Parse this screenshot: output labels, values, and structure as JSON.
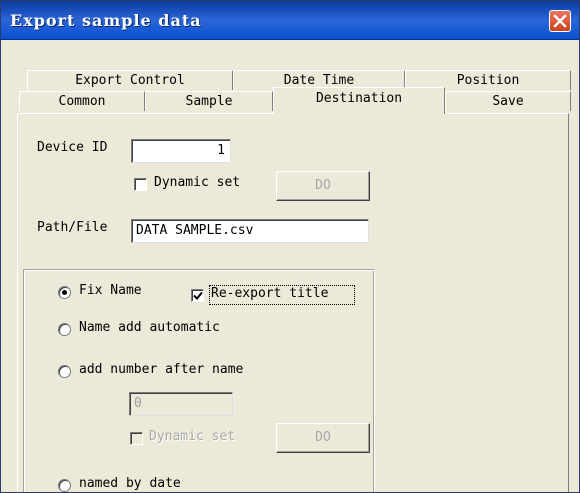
{
  "window": {
    "title": "Export sample data",
    "close_icon": "close-icon"
  },
  "tabs": {
    "back_row": [
      "Export Control",
      "Date Time",
      "Position"
    ],
    "front_row": [
      "Common",
      "Sample",
      "Destination",
      "Save"
    ],
    "active": "Destination"
  },
  "destination": {
    "device_id_label": "Device ID",
    "device_id_value": "1",
    "dynamic_set_label": "Dynamic set",
    "dynamic_set_checked": false,
    "do_button": "DO",
    "path_label": "Path/File",
    "path_value": "DATA SAMPLE.csv",
    "naming": {
      "fix_name": "Fix Name",
      "re_export_title": "Re-export title",
      "re_export_checked": true,
      "name_add_automatic": "Name add automatic",
      "add_number_after_name": "add number after name",
      "number_value": "0",
      "dynamic_set_label": "Dynamic set",
      "do_button": "DO",
      "named_by_date": "named by date",
      "selected": "Fix Name"
    }
  }
}
